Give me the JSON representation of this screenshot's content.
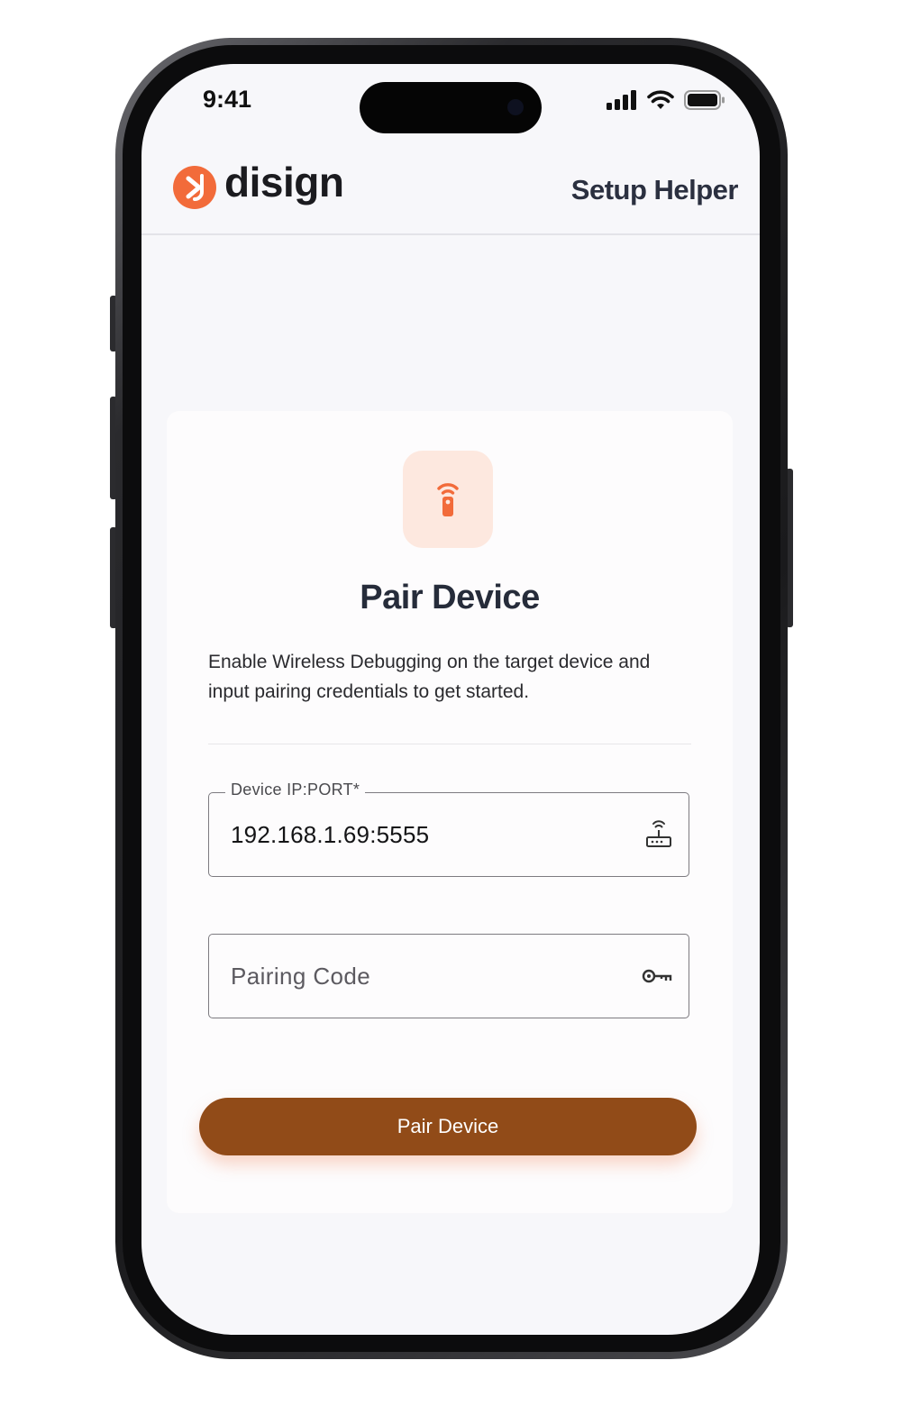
{
  "status_bar": {
    "time": "9:41",
    "icons": [
      "signal-icon",
      "wifi-icon",
      "battery-icon"
    ]
  },
  "header": {
    "brand": "disign",
    "brand_color": "#F26B3A",
    "right_title": "Setup Helper"
  },
  "card": {
    "icon": "remote-icon",
    "title": "Pair Device",
    "description": "Enable Wireless Debugging on the target device and input pairing credentials to get started.",
    "ip_field": {
      "label": "Device IP:PORT*",
      "value": "192.168.1.69:5555",
      "icon": "router-icon"
    },
    "code_field": {
      "placeholder": "Pairing Code",
      "icon": "key-icon"
    },
    "button_label": "Pair Device",
    "button_color": "#914B18"
  }
}
